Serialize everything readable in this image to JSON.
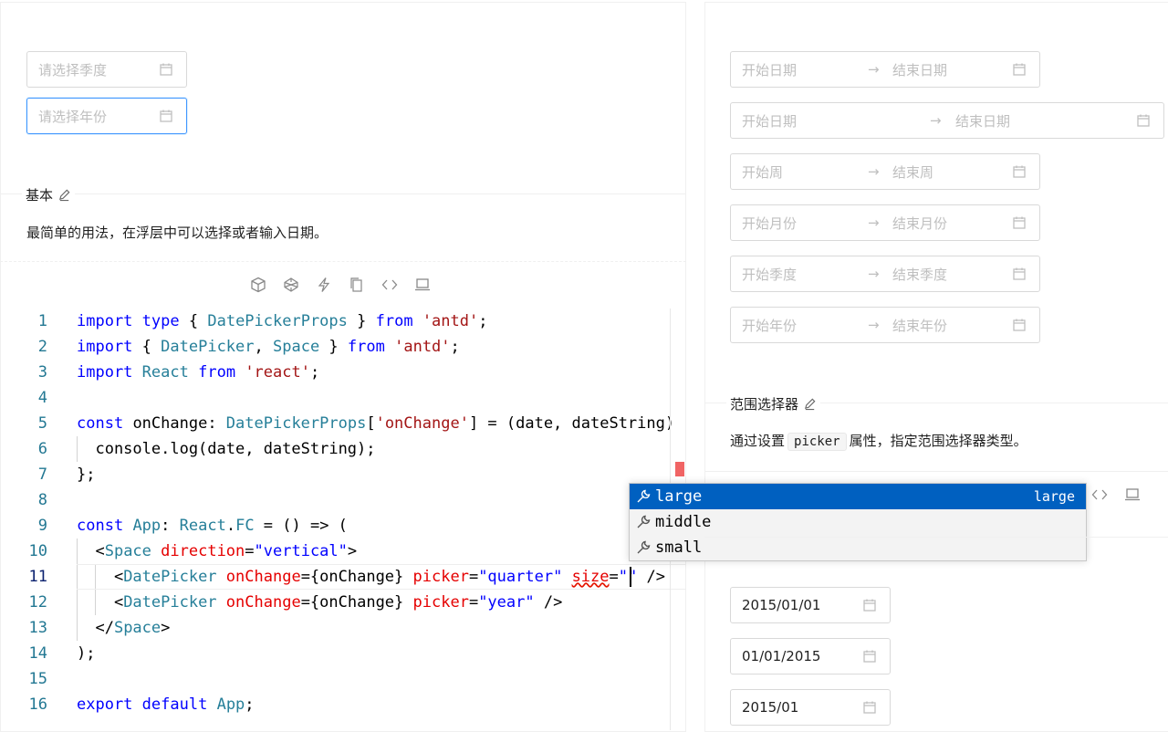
{
  "left_demo": {
    "quarter_placeholder": "请选择季度",
    "year_placeholder": "请选择年份"
  },
  "basic_section": {
    "title": "基本",
    "description": "最简单的用法，在浮层中可以选择或者输入日期。"
  },
  "editor": {
    "line_numbers": [
      "1",
      "2",
      "3",
      "4",
      "5",
      "6",
      "7",
      "8",
      "9",
      "10",
      "11",
      "12",
      "13",
      "14",
      "15",
      "16"
    ],
    "current_line": "11"
  },
  "suggestions": [
    {
      "label": "large",
      "detail": "large",
      "selected": true
    },
    {
      "label": "middle",
      "detail": "",
      "selected": false
    },
    {
      "label": "small",
      "detail": "",
      "selected": false
    }
  ],
  "range_demo": {
    "rows": [
      {
        "start": "开始日期",
        "end": "结束日期"
      },
      {
        "start": "开始日期",
        "end": "结束日期"
      },
      {
        "start": "开始周",
        "end": "结束周"
      },
      {
        "start": "开始月份",
        "end": "结束月份"
      },
      {
        "start": "开始季度",
        "end": "结束季度"
      },
      {
        "start": "开始年份",
        "end": "结束年份"
      }
    ],
    "arrow": "→"
  },
  "range_section": {
    "title": "范围选择器",
    "desc_before": "通过设置",
    "desc_code": "picker",
    "desc_after": "属性，指定范围选择器类型。"
  },
  "format_demo": {
    "values": [
      "2015/01/01",
      "01/01/2015",
      "2015/01"
    ]
  },
  "colors": {
    "selection": "#0060c0",
    "keyword": "#0000ff",
    "type": "#267f99",
    "string": "#a31515",
    "focus_border": "#4096ff"
  }
}
